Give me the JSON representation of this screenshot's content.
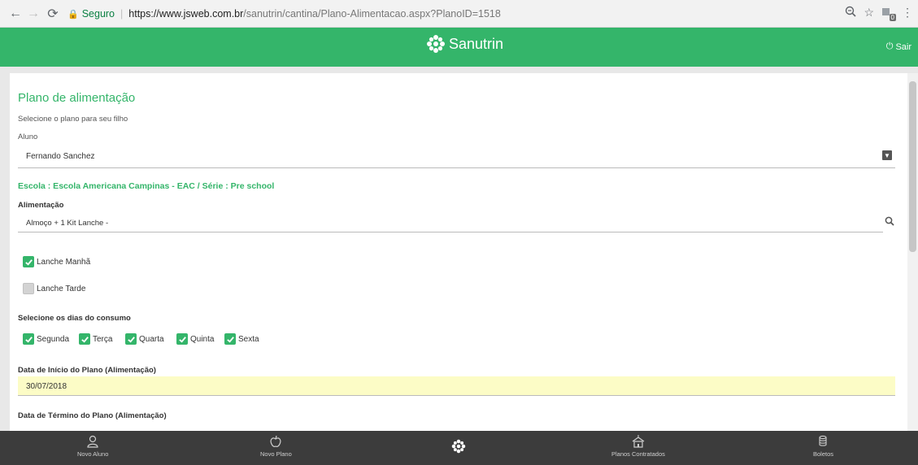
{
  "browser": {
    "secure_label": "Seguro",
    "url_host": "https://www.jsweb.com.br",
    "url_path": "/sanutrin/cantina/Plano-Alimentacao.aspx?PlanoID=1518",
    "ext_badge": "0"
  },
  "header": {
    "brand": "Sanutrin",
    "logout_label": "Sair",
    "colors": {
      "primary": "#34b56a",
      "nav_bg": "#3c3c3c"
    }
  },
  "form": {
    "title": "Plano de alimentação",
    "subtitle": "Selecione o plano para seu filho",
    "student_label": "Aluno",
    "student_value": "Fernando Sanchez",
    "school_line": "Escola : Escola Americana Campinas - EAC / Série : Pre school",
    "food_label": "Alimentação",
    "food_value": "Almoço + 1 Kit Lanche -",
    "snacks": [
      {
        "label": "Lanche Manhã",
        "checked": true
      },
      {
        "label": "Lanche Tarde",
        "checked": false
      }
    ],
    "days_label": "Selecione os dias do consumo",
    "days": [
      {
        "label": "Segunda",
        "checked": true
      },
      {
        "label": "Terça",
        "checked": true
      },
      {
        "label": "Quarta",
        "checked": true
      },
      {
        "label": "Quinta",
        "checked": true
      },
      {
        "label": "Sexta",
        "checked": true
      }
    ],
    "start_label": "Data de Início do Plano (Alimentação)",
    "start_value": "30/07/2018",
    "end_label": "Data de Término do Plano (Alimentação)"
  },
  "bottom_nav": {
    "items": [
      {
        "label": "Novo Aluno",
        "icon": "user-icon"
      },
      {
        "label": "Novo Plano",
        "icon": "apple-icon"
      },
      {
        "label": "",
        "icon": "sanutrin-logo-icon"
      },
      {
        "label": "Planos Contratados",
        "icon": "school-icon"
      },
      {
        "label": "Boletos",
        "icon": "coins-icon"
      }
    ]
  }
}
